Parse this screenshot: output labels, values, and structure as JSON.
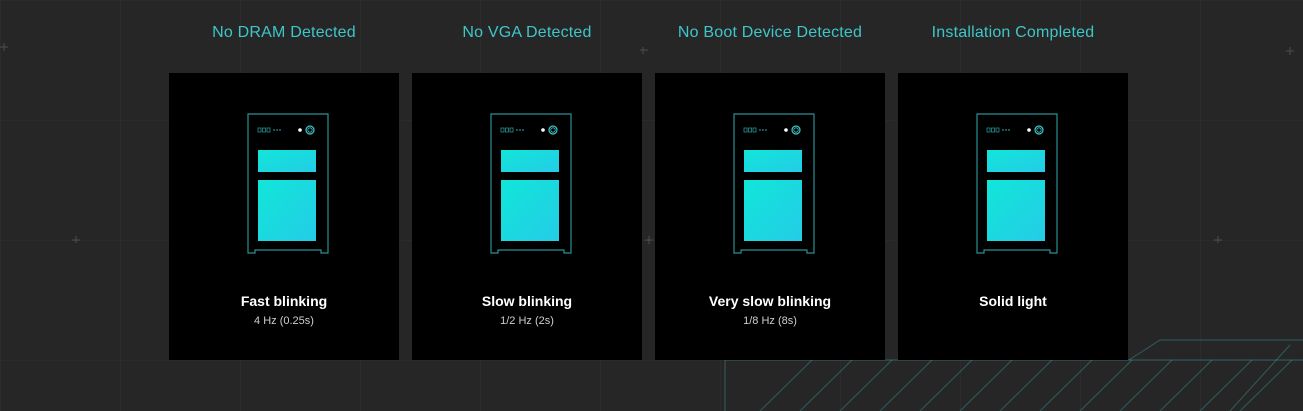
{
  "colors": {
    "accent": "#3ec6c9",
    "background": "#262626",
    "card": "#000000",
    "panel_gradient_start": "#11e6d9",
    "panel_gradient_end": "#24cce6"
  },
  "columns": [
    {
      "title": "No DRAM Detected",
      "label": "Fast blinking",
      "frequency": "4 Hz (0.25s)"
    },
    {
      "title": "No VGA Detected",
      "label": "Slow blinking",
      "frequency": "1/2 Hz (2s)"
    },
    {
      "title": "No Boot Device Detected",
      "label": "Very slow blinking",
      "frequency": "1/8 Hz (8s)"
    },
    {
      "title": "Installation Completed",
      "label": "Solid light",
      "frequency": ""
    }
  ]
}
